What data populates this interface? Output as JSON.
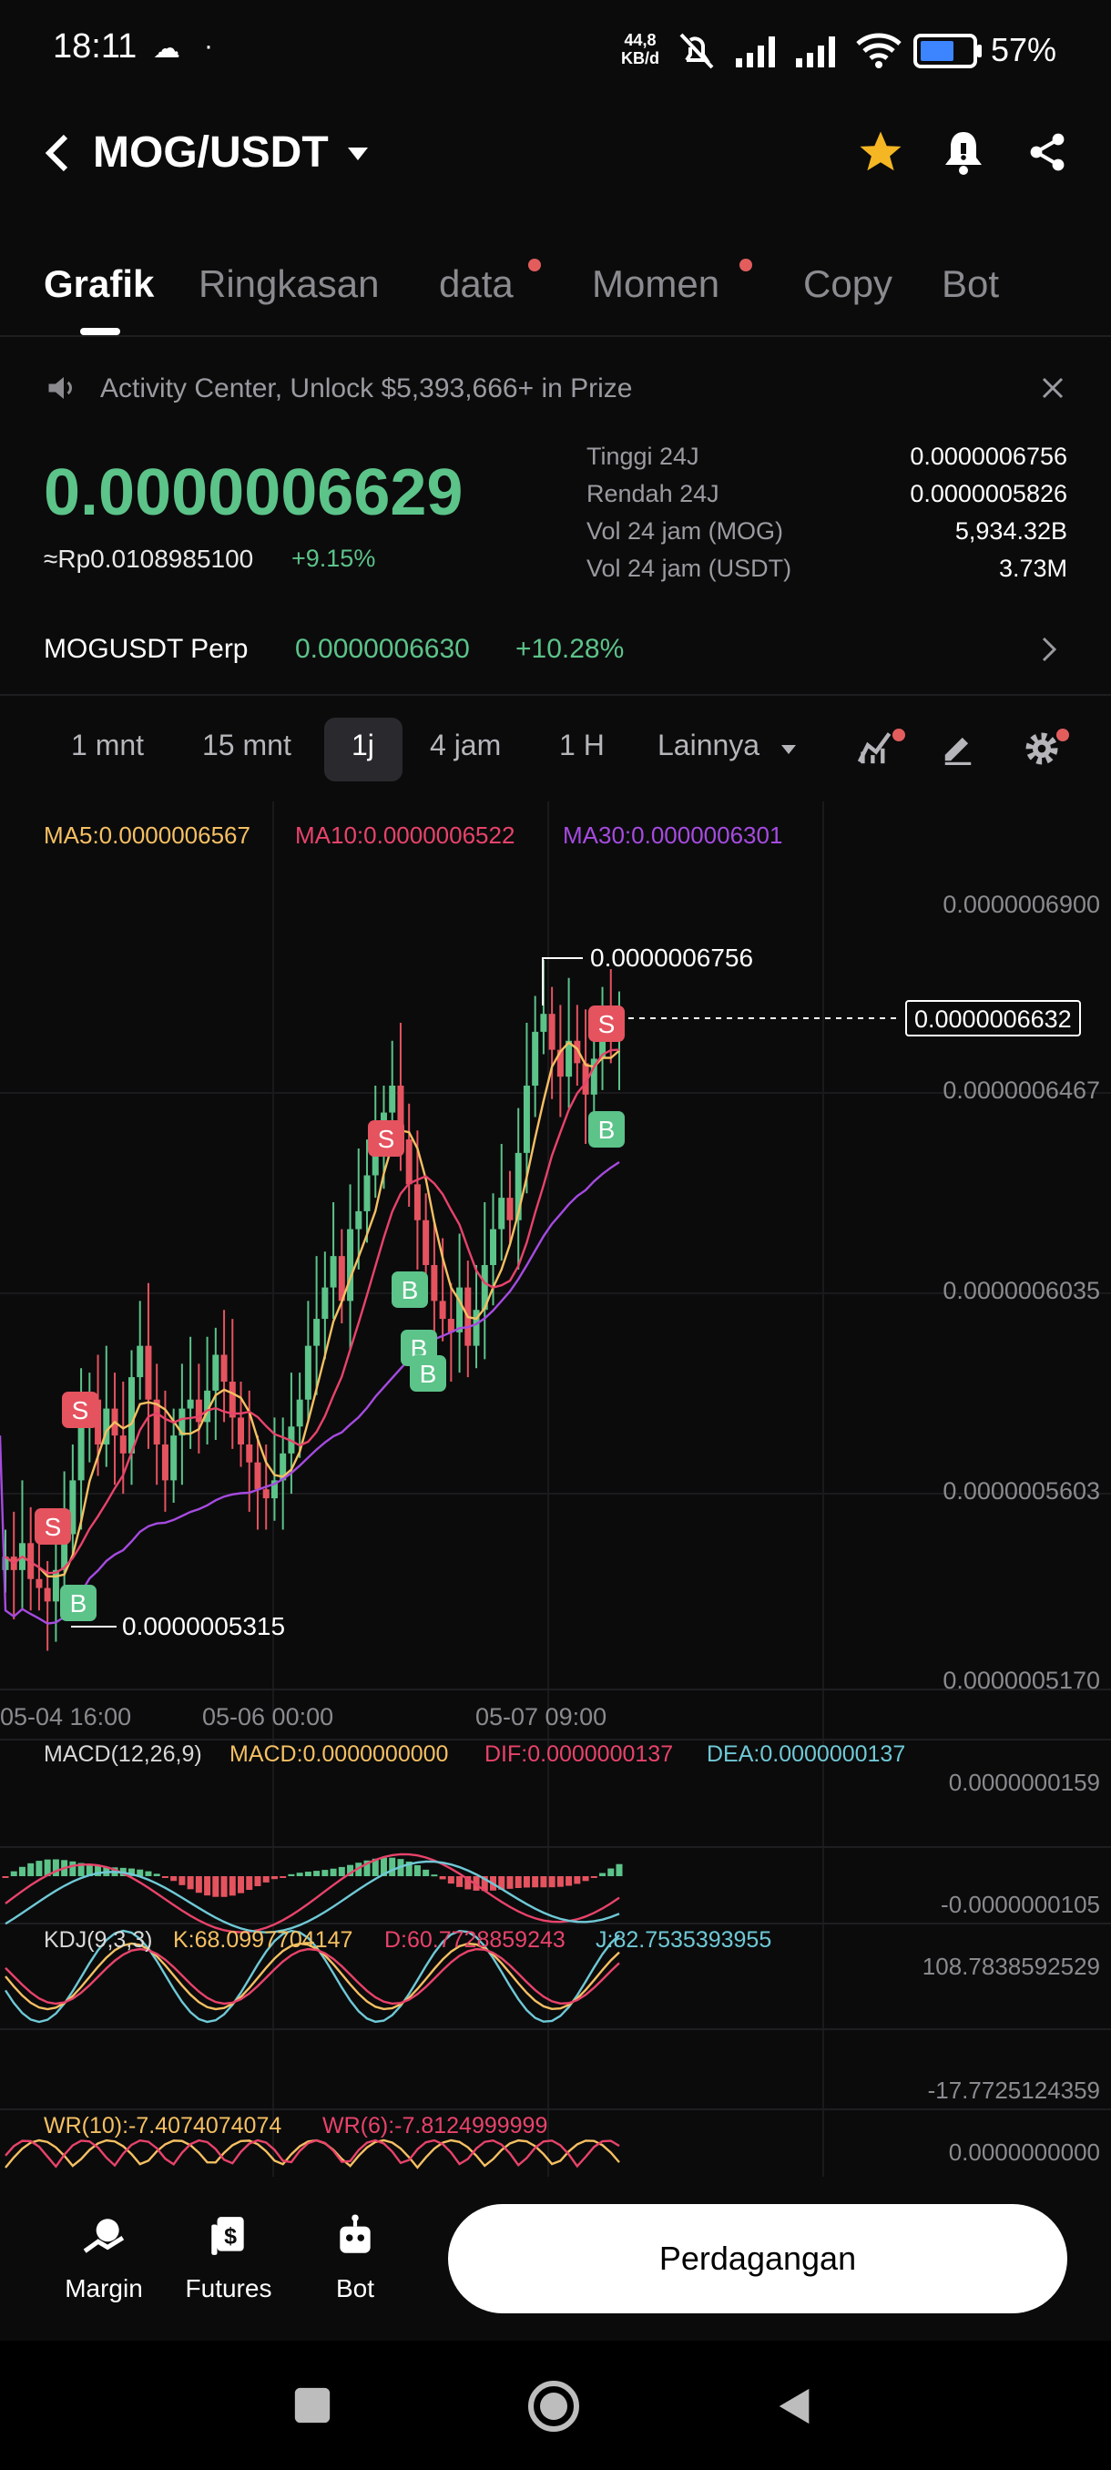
{
  "status_bar": {
    "time": "18:11",
    "net_speed_top": "44,8",
    "net_speed_bottom": "KB/d",
    "battery": "57%"
  },
  "header": {
    "pair": "MOG/USDT"
  },
  "tabs": [
    {
      "label": "Grafik",
      "active": true,
      "dot": false
    },
    {
      "label": "Ringkasan",
      "active": false,
      "dot": false
    },
    {
      "label": "data",
      "active": false,
      "dot": true
    },
    {
      "label": "Momen",
      "active": false,
      "dot": true
    },
    {
      "label": "Copy",
      "active": false,
      "dot": false
    },
    {
      "label": "Bot",
      "active": false,
      "dot": false
    }
  ],
  "banner": {
    "text": "Activity Center, Unlock $5,393,666+ in Prize"
  },
  "price": {
    "last": "0.0000006629",
    "idr": "≈Rp0.0108985100",
    "change": "+9.15%"
  },
  "stats": [
    {
      "label": "Tinggi 24J",
      "value": "0.0000006756"
    },
    {
      "label": "Rendah 24J",
      "value": "0.0000005826"
    },
    {
      "label": "Vol 24 jam (MOG)",
      "value": "5,934.32B"
    },
    {
      "label": "Vol 24 jam (USDT)",
      "value": "3.73M"
    }
  ],
  "perp": {
    "name": "MOGUSDT Perp",
    "price": "0.0000006630",
    "change": "+10.28%"
  },
  "timeframes": {
    "items": [
      "1 mnt",
      "15 mnt",
      "1j",
      "4 jam",
      "1 H",
      "Lainnya"
    ],
    "selected": "1j"
  },
  "indicators": {
    "ma5": "MA5:0.0000006567",
    "ma10": "MA10:0.0000006522",
    "ma30": "MA30:0.0000006301",
    "macd_title": "MACD(12,26,9)",
    "macd": "MACD:0.0000000000",
    "dif": "DIF:0.0000000137",
    "dea": "DEA:0.0000000137",
    "kdj_title": "KDJ(9,3,3)",
    "k": "K:68.0997704147",
    "d": "D:60.7728859243",
    "j": "J:82.7535393955",
    "wr10": "WR(10):-7.4074074074",
    "wr6": "WR(6):-7.8124999999"
  },
  "chart_data": {
    "type": "candlestick",
    "price_axis": [
      "0.0000006900",
      "0.0000006467",
      "0.0000006035",
      "0.0000005603",
      "0.0000005170"
    ],
    "x_axis": [
      "05-04 16:00",
      "05-06 00:00",
      "05-07 09:00"
    ],
    "high_marker": "0.0000006756",
    "low_marker": "0.0000005315",
    "current_price_tag": "0.0000006632",
    "macd_axis": [
      "0.0000000159",
      "-0.0000000105"
    ],
    "kdj_axis": [
      "108.7838592529",
      "-17.7725124359"
    ],
    "wr_axis": [
      "0.0000000000"
    ],
    "colors": {
      "up": "#5cc389",
      "down": "#e5535f",
      "ma5": "#f5c062",
      "ma10": "#e8436a",
      "ma30": "#a64be0",
      "dea": "#6fc9d6"
    },
    "trade_marks": [
      "S",
      "S",
      "B",
      "S",
      "B",
      "B",
      "B",
      "S",
      "B"
    ]
  },
  "bottom": {
    "items": [
      {
        "label": "Margin",
        "icon": "margin-icon"
      },
      {
        "label": "Futures",
        "icon": "futures-icon"
      },
      {
        "label": "Bot",
        "icon": "bot-icon"
      }
    ],
    "trade_button": "Perdagangan"
  }
}
